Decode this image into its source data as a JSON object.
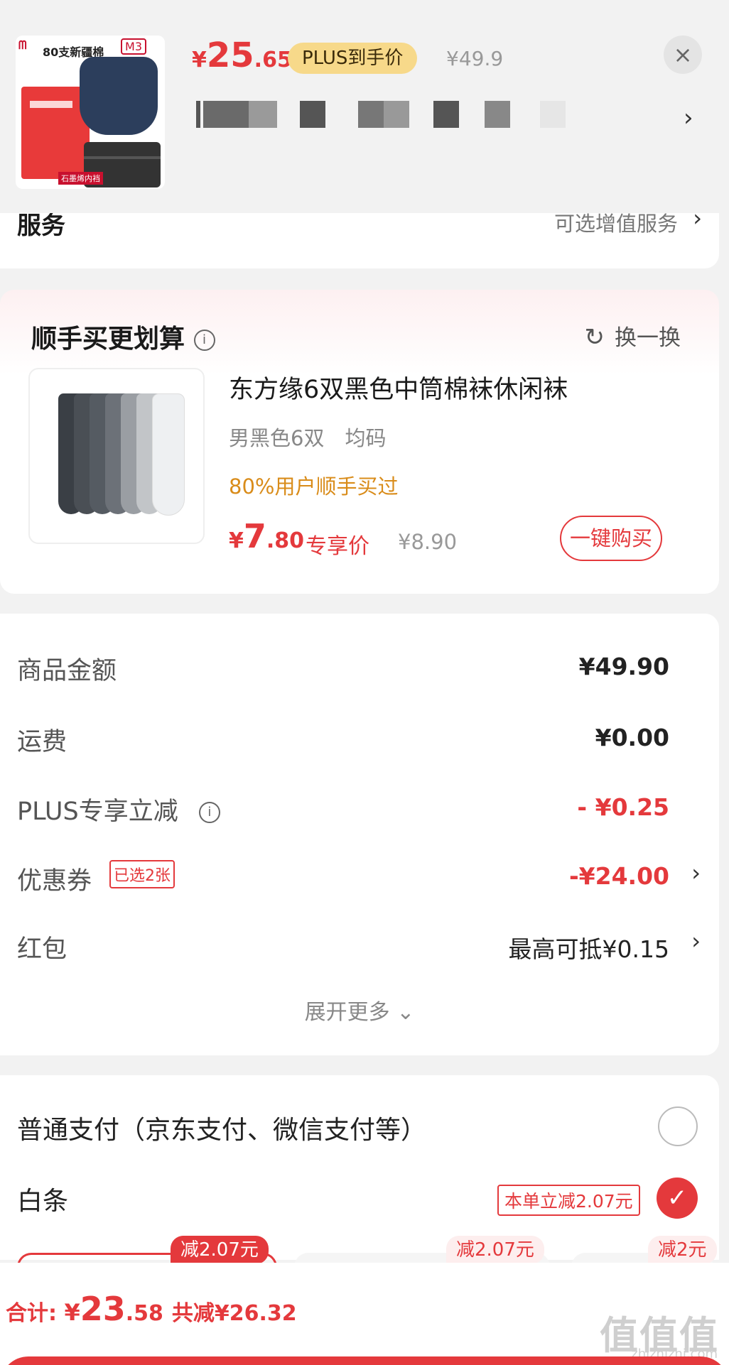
{
  "header": {
    "thumb": {
      "brand": "MIIOW",
      "tagline": "80支新疆棉",
      "size": "M3",
      "label": "石墨烯内裆"
    },
    "price": {
      "symbol": "¥",
      "integer": "25",
      "decimal": ".65"
    },
    "plus_badge": "PLUS到手价",
    "original_price": "¥49.9",
    "close_label": "×",
    "arrow": "›"
  },
  "service": {
    "title": "服务",
    "value": "可选增值服务",
    "arrow": "›"
  },
  "addon": {
    "title": "顺手买更划算",
    "info": "i",
    "swap_label": "换一换",
    "refresh_icon": "↻",
    "product": {
      "name": "东方缘6双黑色中筒棉袜休闲袜",
      "spec": "男黑色6双　均码",
      "hint": "80%用户顺手买过",
      "price": {
        "symbol": "¥",
        "integer": "7",
        "decimal": ".80"
      },
      "price_tag": "专享价",
      "original_price": "¥8.90",
      "buy_label": "一键购买"
    }
  },
  "summary": {
    "rows": [
      {
        "label": "商品金额",
        "value": "¥49.90"
      },
      {
        "label": "运费",
        "value": "¥0.00"
      },
      {
        "label": "PLUS专享立减",
        "value": "- ¥0.25"
      },
      {
        "label": "优惠券",
        "value": "-¥24.00",
        "badge": "已选2张"
      },
      {
        "label": "红包",
        "value": "最高可抵¥0.15"
      }
    ],
    "info": "i",
    "arrow": "›",
    "expand_label": "展开更多 ⌄"
  },
  "payment": {
    "normal_label": "普通支付（京东支付、微信支付等）",
    "baitiao_label": "白条",
    "baitiao_badge": "本单立减2.07元",
    "check": "✓",
    "plans": [
      {
        "tag": "减2.07元"
      },
      {
        "tag": "减2.07元"
      },
      {
        "tag": "减2元"
      }
    ]
  },
  "footer": {
    "total_label": "合计: ",
    "total": {
      "symbol": "¥",
      "integer": "23",
      "decimal": ".58"
    },
    "saved": "共减¥26.32",
    "watermark": "值值值",
    "watermark_sub": "zhizhizhi.com"
  },
  "colors": {
    "accent_red": "#e4393c",
    "plus_gold": "#f7d98a",
    "hint_orange": "#d98c1a",
    "background": "#f2f2f2"
  }
}
